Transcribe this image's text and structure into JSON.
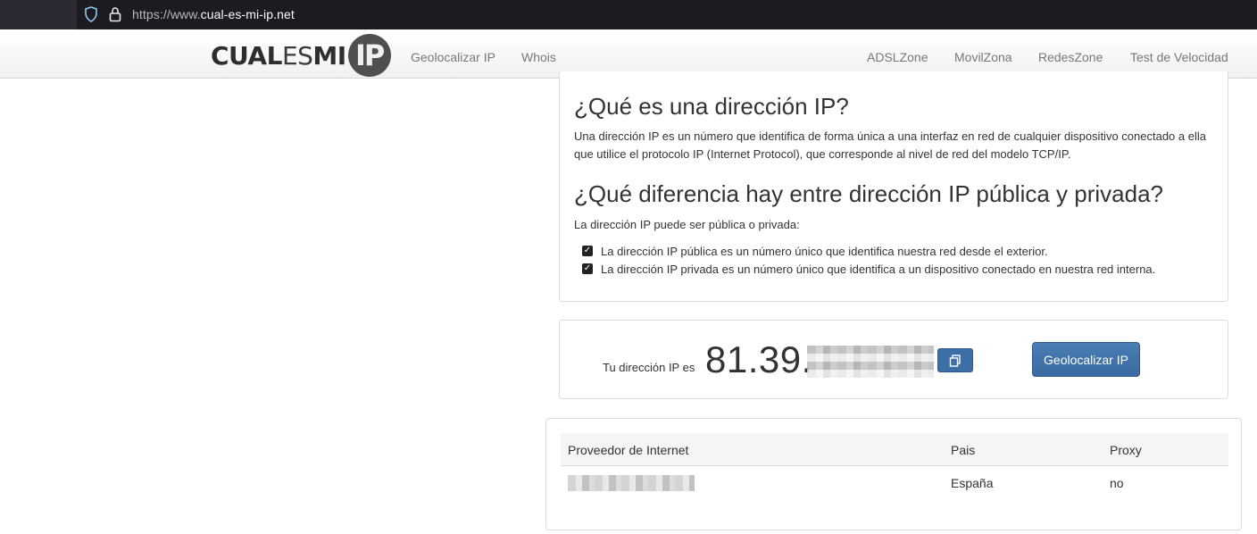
{
  "browser": {
    "url_scheme": "https://www.",
    "url_host": "cual-es-mi-ip.net"
  },
  "navbar": {
    "logo": {
      "part1": "CUAL",
      "part2": "ES",
      "part3": "MI",
      "badge": "IP"
    },
    "left_links": [
      "Geolocalizar IP",
      "Whois"
    ],
    "right_links": [
      "ADSLZone",
      "MovilZona",
      "RedesZone",
      "Test de Velocidad"
    ]
  },
  "info": {
    "heading1": "¿Qué es una dirección IP?",
    "paragraph1": "Una dirección IP es un número que identifica de forma única a una interfaz en red de cualquier dispositivo conectado a ella que utilice el protocolo IP (Internet Protocol), que corresponde al nivel de red del modelo TCP/IP.",
    "heading2": "¿Qué diferencia hay entre dirección IP pública y privada?",
    "paragraph2": "La dirección IP puede ser pública o privada:",
    "list": [
      "La dirección IP pública es un número único que identifica nuestra red desde el exterior.",
      "La dirección IP privada es un número único que identifica a un dispositivo conectado en nuestra red interna."
    ]
  },
  "ip_box": {
    "label": "Tu dirección IP es",
    "ip_visible": "81.39.",
    "copy_icon": "copy-icon",
    "geo_button": "Geolocalizar IP"
  },
  "table": {
    "headers": [
      "Proveedor de Internet",
      "Pais",
      "Proxy"
    ],
    "row": {
      "pais": "España",
      "proxy": "no"
    }
  }
}
